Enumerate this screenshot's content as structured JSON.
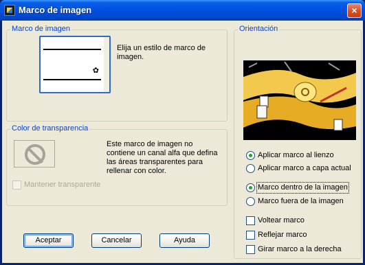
{
  "window": {
    "title": "Marco de imagen",
    "close_glyph": "×"
  },
  "frame_group": {
    "label": "Marco de imagen",
    "description": "Elija un estilo de marco de imagen."
  },
  "transparency_group": {
    "label": "Color de transparencia",
    "description": "Este marco de imagen no contiene un canal alfa que defina las áreas transparentes para rellenar con color.",
    "keep_transparent_label": "Mantener transparente",
    "keep_transparent_checked": false,
    "keep_transparent_enabled": false
  },
  "orientation_group": {
    "label": "Orientación",
    "apply_options": [
      {
        "label": "Aplicar marco al lienzo",
        "checked": true
      },
      {
        "label": "Aplicar marco a capa actual",
        "checked": false
      }
    ],
    "position_options": [
      {
        "label": "Marco dentro de la imagen",
        "checked": true
      },
      {
        "label": "Marco fuera de la imagen",
        "checked": false
      }
    ],
    "checkboxes": [
      {
        "label": "Voltear marco",
        "checked": false
      },
      {
        "label": "Reflejar marco",
        "checked": false
      },
      {
        "label": "Girar marco a la derecha",
        "checked": false
      }
    ]
  },
  "buttons": {
    "ok": "Aceptar",
    "cancel": "Cancelar",
    "help": "Ayuda"
  },
  "colors": {
    "titlebar": "#0054e3",
    "group_label": "#0046d5",
    "dialog_bg": "#ece9d8"
  }
}
